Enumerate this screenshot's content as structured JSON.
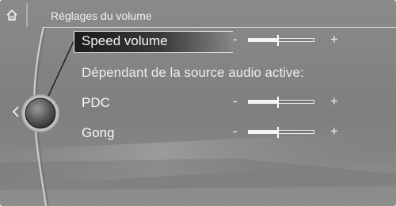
{
  "header": {
    "title": "Réglages du volume"
  },
  "icons": {
    "home": "home-icon",
    "back": "chevron-left-icon",
    "controller": "idrive-controller-icon"
  },
  "menu": {
    "items": [
      {
        "label": "Speed volume",
        "minus": "-",
        "plus": "+",
        "level": 0.45,
        "selected": true
      },
      {
        "label": "PDC",
        "minus": "-",
        "plus": "+",
        "level": 0.45,
        "selected": false
      },
      {
        "label": "Gong",
        "minus": "-",
        "plus": "+",
        "level": 0.45,
        "selected": false
      }
    ],
    "section_label": "Dépendant de la source audio active:"
  },
  "colors": {
    "background": "#8d8d8d",
    "text": "#f2f2f2",
    "selected_bg": "#1b1b1b"
  }
}
